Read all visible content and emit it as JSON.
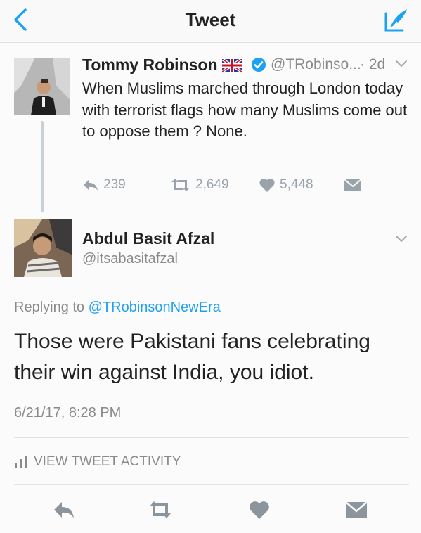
{
  "header": {
    "title": "Tweet"
  },
  "original_tweet": {
    "author_name": "Tommy Robinson",
    "handle": "@TRobinso...",
    "time": "· 2d",
    "text": "When Muslims marched through London today with terrorist flags how many Muslims come out to oppose them ? None.",
    "replies": "239",
    "retweets": "2,649",
    "likes": "5,448"
  },
  "reply_tweet": {
    "author_name": "Abdul Basit Afzal",
    "handle": "@itsabasitafzal",
    "replying_prefix": "Replying to",
    "replying_mention": "@TRobinsonNewEra",
    "text": "Those were Pakistani fans celebrating their win against India, you idiot.",
    "timestamp": "6/21/17, 8:28 PM",
    "activity_label": "VIEW TWEET ACTIVITY"
  },
  "colors": {
    "accent": "#1da1f2",
    "muted": "#8a8a8a",
    "action_gray": "#9aa3ab",
    "verified": "#1da1f2"
  },
  "icons": [
    "back-chevron-icon",
    "compose-icon",
    "uk-flag-icon",
    "verified-icon",
    "chevron-down-icon",
    "reply-icon",
    "retweet-icon",
    "like-heart-icon",
    "direct-message-icon",
    "activity-bars-icon"
  ]
}
